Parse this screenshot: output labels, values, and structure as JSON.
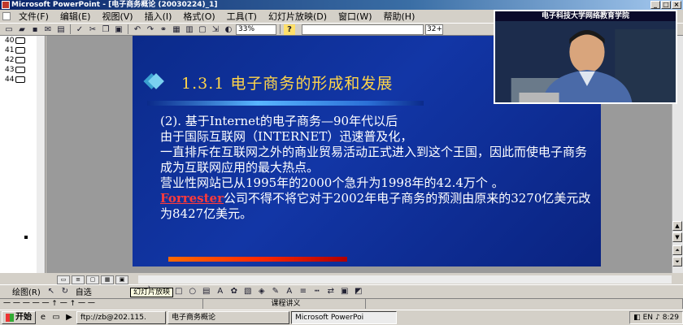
{
  "window": {
    "title": "Microsoft PowerPoint - [电子商务概论 (20030224)_1]",
    "controls": [
      "_",
      "□",
      "×"
    ]
  },
  "menu": [
    "文件(F)",
    "编辑(E)",
    "视图(V)",
    "插入(I)",
    "格式(O)",
    "工具(T)",
    "幻灯片放映(D)",
    "窗口(W)",
    "帮助(H)"
  ],
  "toolbar": {
    "zoom": "33%",
    "help": "?",
    "font_size": "32+"
  },
  "outline": {
    "slides": [
      "40",
      "41",
      "42",
      "43",
      "44"
    ]
  },
  "slide": {
    "heading": "1.3.1  电子商务的形成和发展",
    "lines": [
      "(2). 基于Internet的电子商务—90年代以后",
      "由于国际互联网（INTERNET）迅速普及化，",
      "一直排斥在互联网之外的商业贸易活动正式进入到这个王国，因此而使电子商务成为互联网应用的最大热点。",
      "营业性网站已从1995年的2000个急升为1998年的42.4万个  。"
    ],
    "last_before": "",
    "forrester": "Forrester",
    "last_after": "公司不得不将它对于2002年电子商务的预测由原来的3270亿美元改为8427亿美元。"
  },
  "drawbar": {
    "draw_label": "绘图(R)",
    "autoshape_label": "自选",
    "tooltip": "幻灯片放映"
  },
  "status": {
    "left": "一 一 一 一 一 ↑ 一 ↑ 一 一",
    "mid": "课程讲义"
  },
  "taskbar": {
    "start": "开始",
    "tasks": [
      "ftp://zb@202.115.",
      "电子商务概论",
      "Microsoft PowerPoi"
    ],
    "ime": "EN",
    "time": "8:29"
  },
  "video": {
    "title": "电子科技大学网络教育学院"
  }
}
